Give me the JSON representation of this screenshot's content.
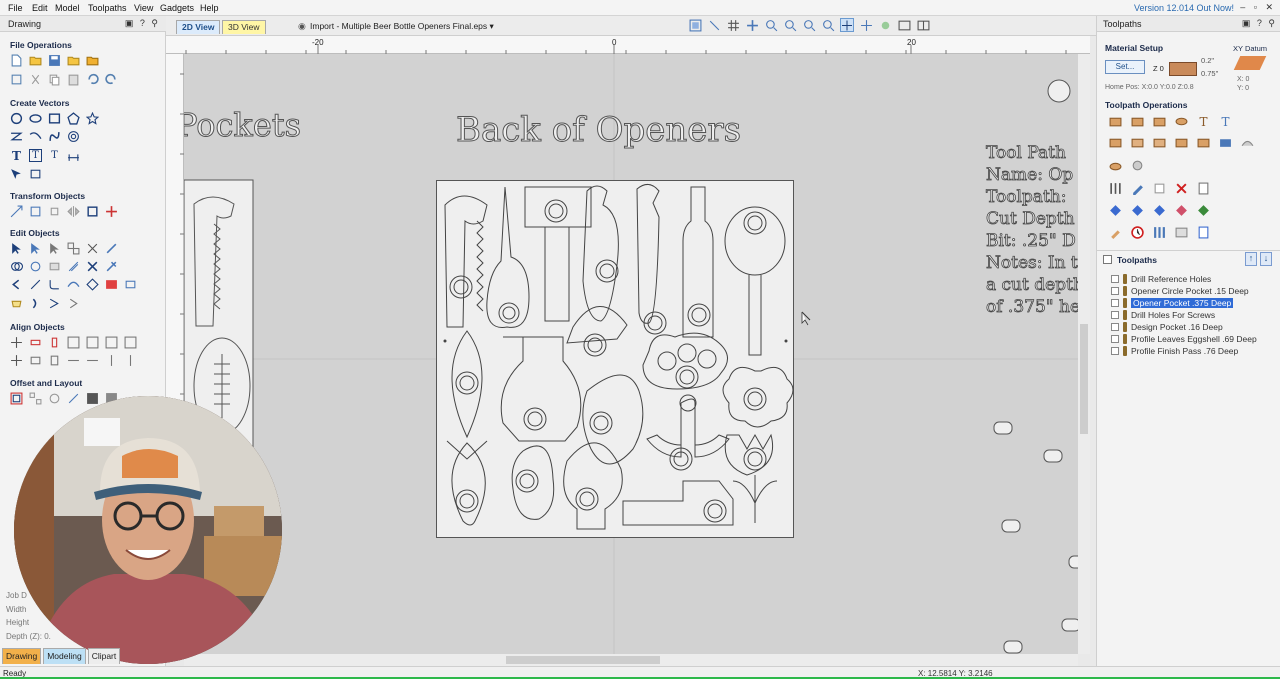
{
  "menubar": {
    "items": [
      "File",
      "Edit",
      "Model",
      "Toolpaths",
      "View",
      "Gadgets",
      "Help"
    ],
    "version_notice": "Version 12.014 Out Now!"
  },
  "left_panel": {
    "title": "Drawing",
    "sections": {
      "file_operations": "File Operations",
      "create_vectors": "Create Vectors",
      "transform_objects": "Transform Objects",
      "edit_objects": "Edit Objects",
      "align_objects": "Align Objects",
      "offset_layout": "Offset and Layout"
    },
    "job_info_partial": [
      "Job D",
      "Width",
      "Height",
      "Depth (Z): 0."
    ]
  },
  "canvas": {
    "tab_2d": "2D View",
    "tab_3d": "3D View",
    "import_name": "Import - Multiple Beer Bottle Openers Final.eps",
    "ruler_labels": [
      "-20",
      "0",
      "20"
    ],
    "text_pockets": "Pockets",
    "text_back": "Back of Openers",
    "notes_lines": [
      "Tool Path",
      "Name: Op",
      "Toolpath: ",
      "Cut Depth",
      "Bit: .25\" D",
      "Notes: In t",
      "a cut depth",
      "of .375\" he"
    ]
  },
  "bottom_tabs": [
    "Drawing",
    "Modeling",
    "Clipart"
  ],
  "status": {
    "ready": "Ready",
    "coords": "X: 12.5814 Y: 3.2146"
  },
  "right_panel": {
    "title": "Toolpaths",
    "material_setup": "Material Setup",
    "set_button": "Set...",
    "z0_label": "Z 0",
    "z_top": "0.2\"",
    "z_thick": "0.75\"",
    "home_pos": "Home Pos:  X:0.0 Y:0.0 Z:0.8",
    "xy_datum": "XY Datum",
    "datum_x": "X: 0",
    "datum_y": "Y: 0",
    "operations": "Toolpath Operations",
    "toolpaths_heading": "Toolpaths",
    "toolpaths": [
      {
        "label": "Drill Reference Holes",
        "selected": false
      },
      {
        "label": "Opener Circle Pocket .15 Deep",
        "selected": false
      },
      {
        "label": "Opener Pocket .375 Deep",
        "selected": true
      },
      {
        "label": "Drill Holes For Screws",
        "selected": false
      },
      {
        "label": "Design Pocket .16 Deep",
        "selected": false
      },
      {
        "label": "Profile Leaves Eggshell .69 Deep",
        "selected": false
      },
      {
        "label": "Profile Finish Pass .76 Deep",
        "selected": false
      }
    ]
  },
  "colors": {
    "accent": "#2f6bd6",
    "drawing_tab": "#f2b04a",
    "status_green": "#2db84a"
  }
}
